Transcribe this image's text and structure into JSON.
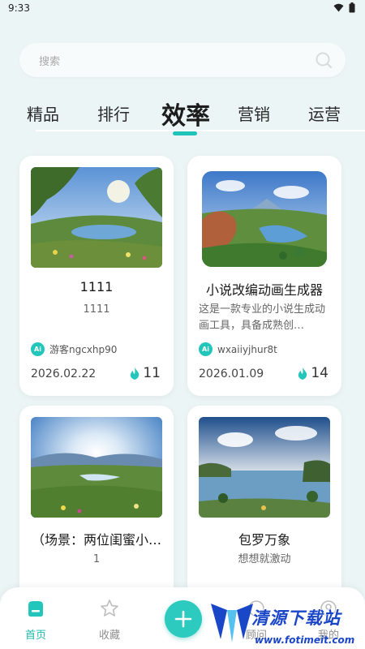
{
  "status": {
    "time": "9:33"
  },
  "search": {
    "placeholder": "搜索"
  },
  "tabs": [
    {
      "label": "精品",
      "active": false
    },
    {
      "label": "排行",
      "active": false
    },
    {
      "label": "效率",
      "active": true
    },
    {
      "label": "营销",
      "active": false
    },
    {
      "label": "运营",
      "active": false
    }
  ],
  "cards": [
    {
      "title": "1111",
      "description": "1111",
      "author": "游客ngcxhp90",
      "date": "2026.02.22",
      "hot": "11",
      "ai_badge": "Ai"
    },
    {
      "title": "小说改编动画生成器",
      "description": "这是一款专业的小说生成动画工具，具备成熟创…",
      "author": "wxaiiyjhur8t",
      "date": "2026.01.09",
      "hot": "14",
      "ai_badge": "Ai"
    },
    {
      "title": "（场景：两位闺蜜小…",
      "description": "1"
    },
    {
      "title": "包罗万象",
      "description": "想想就激动"
    }
  ],
  "nav": {
    "home": "首页",
    "favorites": "收藏",
    "advisor": "顾问",
    "mine": "我的"
  },
  "watermark": {
    "text": "清源下载站",
    "url": "www.fotimeit.com"
  },
  "colors": {
    "accent": "#1fc3b8",
    "hot": "#23c6ba",
    "background": "#ecf5f6"
  }
}
